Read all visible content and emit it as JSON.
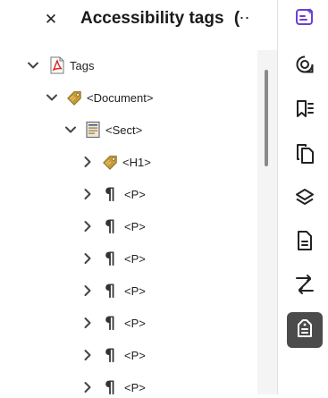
{
  "panel": {
    "title": "Accessibility tags",
    "title_trailing": "(",
    "close_glyph": "✕",
    "more_glyph": "⋯"
  },
  "tree": {
    "root": {
      "label": "Tags",
      "icon": "pdf-file-icon",
      "expanded": true
    },
    "document": {
      "label": "<Document>",
      "icon": "tag-icon",
      "expanded": true
    },
    "sect": {
      "label": "<Sect>",
      "icon": "container-doc-icon",
      "expanded": true
    },
    "children": [
      {
        "label": "<H1>",
        "icon": "tag-icon"
      },
      {
        "label": "<P>",
        "icon": "pilcrow-icon"
      },
      {
        "label": "<P>",
        "icon": "pilcrow-icon"
      },
      {
        "label": "<P>",
        "icon": "pilcrow-icon"
      },
      {
        "label": "<P>",
        "icon": "pilcrow-icon"
      },
      {
        "label": "<P>",
        "icon": "pilcrow-icon"
      },
      {
        "label": "<P>",
        "icon": "pilcrow-icon"
      },
      {
        "label": "<P>",
        "icon": "pilcrow-icon"
      }
    ]
  },
  "pilcrow": "¶",
  "rail": {
    "items": [
      {
        "name": "ai-assistant-icon"
      },
      {
        "name": "comments-icon"
      },
      {
        "name": "bookmarks-icon"
      },
      {
        "name": "copy-pages-icon"
      },
      {
        "name": "layers-icon"
      },
      {
        "name": "document-icon"
      },
      {
        "name": "compare-icon"
      },
      {
        "name": "accessibility-tags-icon",
        "active": true
      }
    ]
  },
  "colors": {
    "accent_purple": "#6b3fd6",
    "active_rail_bg": "#4b4b4b",
    "tag_gold": "#c79a3a",
    "pdf_red": "#d7291e"
  }
}
